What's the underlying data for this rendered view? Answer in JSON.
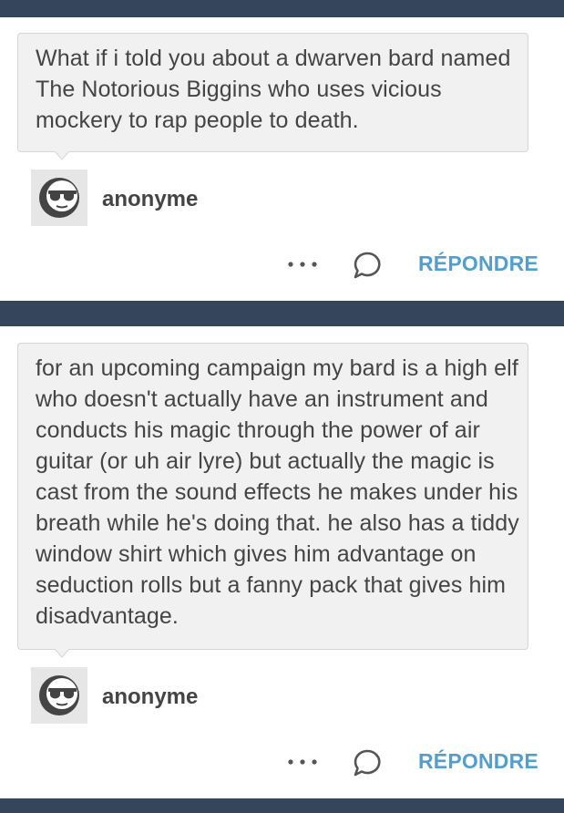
{
  "colors": {
    "bar": "#35465c",
    "bubble_bg": "#f1f1f1",
    "bubble_border": "#d6d6d6",
    "text": "#444444",
    "accent": "#529ecc",
    "icon": "#555555"
  },
  "posts": [
    {
      "question": "What if i told you about a dwarven bard named The Notorious Biggins who uses vicious mockery to rap people to death.",
      "asker": "anonyme",
      "avatar_icon": "anonymous-sunglasses-avatar-icon",
      "more_icon": "more-dots-icon",
      "reply_icon": "speech-bubble-icon",
      "reply_label": "RÉPONDRE"
    },
    {
      "question": "for an upcoming campaign my bard is a high elf who doesn't actually have an instrument and conducts his magic through the power of air guitar (or uh air lyre) but actually the magic is cast from the sound effects he makes under his breath while he's doing that. he also has a tiddy window shirt which gives him advantage on seduction rolls but a fanny pack that gives him disadvantage.",
      "asker": "anonyme",
      "avatar_icon": "anonymous-sunglasses-avatar-icon",
      "more_icon": "more-dots-icon",
      "reply_icon": "speech-bubble-icon",
      "reply_label": "RÉPONDRE"
    }
  ]
}
